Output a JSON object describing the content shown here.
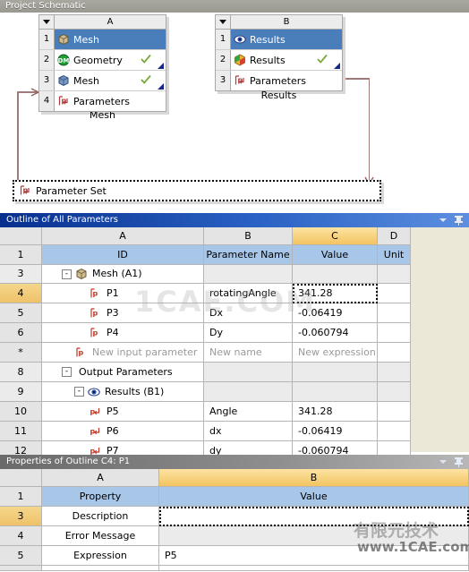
{
  "schematic": {
    "title": "Project Schematic",
    "systems": [
      {
        "letter": "A",
        "caption": "Mesh",
        "rows": [
          {
            "num": "1",
            "label": "Mesh",
            "icon": "mesh-block-icon",
            "selected": true,
            "check": false,
            "corner": false
          },
          {
            "num": "2",
            "label": "Geometry",
            "icon": "design-modeler-icon",
            "selected": false,
            "check": true,
            "corner": true
          },
          {
            "num": "3",
            "label": "Mesh",
            "icon": "mesh-cube-icon",
            "selected": false,
            "check": true,
            "corner": true
          },
          {
            "num": "4",
            "label": "Parameters",
            "icon": "parameter-icon",
            "selected": false,
            "check": false,
            "corner": false
          }
        ]
      },
      {
        "letter": "B",
        "caption": "Results",
        "rows": [
          {
            "num": "1",
            "label": "Results",
            "icon": "results-eye-icon",
            "selected": true,
            "check": false,
            "corner": false
          },
          {
            "num": "2",
            "label": "Results",
            "icon": "cfd-post-icon",
            "selected": false,
            "check": true,
            "corner": true
          },
          {
            "num": "3",
            "label": "Parameters",
            "icon": "parameter-icon",
            "selected": false,
            "check": false,
            "corner": false
          }
        ]
      }
    ],
    "parameter_set": {
      "label": "Parameter Set",
      "icon": "parameter-icon"
    }
  },
  "outline_panel": {
    "title": "Outline of All Parameters",
    "caret_icon": "chevron-down-icon",
    "pin_icon": "pin-icon",
    "columns": [
      "",
      "A",
      "B",
      "C",
      "D"
    ],
    "highlight_column": "C",
    "header_row": {
      "num": "1",
      "cells": [
        "ID",
        "Parameter Name",
        "Value",
        "Unit"
      ]
    },
    "rows": [
      {
        "num": "3",
        "style": "group",
        "indent": 1,
        "toggle": "-",
        "icon": "mesh-block-icon",
        "id": "Mesh (A1)",
        "name": "",
        "value": "",
        "unit": ""
      },
      {
        "num": "4",
        "style": "current",
        "indent": 3,
        "toggle": "",
        "icon": "param-in-icon",
        "id": "P1",
        "name": "rotatingAngle",
        "value": "341.28",
        "unit": "",
        "value_focus": true
      },
      {
        "num": "5",
        "style": "normal",
        "indent": 3,
        "toggle": "",
        "icon": "param-in-icon",
        "id": "P3",
        "name": "Dx",
        "value": "-0.06419",
        "unit": ""
      },
      {
        "num": "6",
        "style": "normal",
        "indent": 3,
        "toggle": "",
        "icon": "param-in-icon",
        "id": "P4",
        "name": "Dy",
        "value": "-0.060794",
        "unit": ""
      },
      {
        "num": "*",
        "style": "ghost",
        "indent": 3,
        "toggle": "",
        "icon": "param-in-icon",
        "id": "New input parameter",
        "name": "New name",
        "value": "New expression",
        "unit": ""
      },
      {
        "num": "8",
        "style": "group",
        "indent": 1,
        "toggle": "-",
        "icon": "",
        "id": "Output Parameters",
        "name": "",
        "value": "",
        "unit": ""
      },
      {
        "num": "9",
        "style": "group",
        "indent": 2,
        "toggle": "-",
        "icon": "results-eye-icon",
        "id": "Results (B1)",
        "name": "",
        "value": "",
        "unit": ""
      },
      {
        "num": "10",
        "style": "normal",
        "indent": 3,
        "toggle": "",
        "icon": "param-out-icon",
        "id": "P5",
        "name": "Angle",
        "value": "341.28",
        "unit": ""
      },
      {
        "num": "11",
        "style": "normal",
        "indent": 3,
        "toggle": "",
        "icon": "param-out-icon",
        "id": "P6",
        "name": "dx",
        "value": "-0.06419",
        "unit": ""
      },
      {
        "num": "12",
        "style": "normal",
        "indent": 3,
        "toggle": "",
        "icon": "param-out-icon",
        "id": "P7",
        "name": "dy",
        "value": "-0.060794",
        "unit": ""
      }
    ]
  },
  "properties_panel": {
    "title": "Properties of Outline C4: P1",
    "caret_icon": "chevron-down-icon",
    "pin_icon": "pin-icon",
    "columns": [
      "",
      "A",
      "B"
    ],
    "highlight_column": "B",
    "header_row": {
      "num": "1",
      "cells": [
        "Property",
        "Value"
      ]
    },
    "rows": [
      {
        "num": "3",
        "style": "current",
        "property": "Description",
        "value": "",
        "value_focus": true
      },
      {
        "num": "4",
        "style": "gray",
        "property": "Error Message",
        "value": ""
      },
      {
        "num": "5",
        "style": "normal",
        "property": "Expression",
        "value": "P5"
      }
    ]
  },
  "watermarks": {
    "main": "1CAE.COM",
    "cn": "有限元技术",
    "url": "www.1CAE.com"
  },
  "colors": {
    "selection_blue": "#4a7ebb",
    "header_blue": "#a8c6e8",
    "amber_column": "#f3c461",
    "panel_blue": "#0b3a9e",
    "panel_gray": "#7a7a7a",
    "connector": "#a07a7a"
  }
}
